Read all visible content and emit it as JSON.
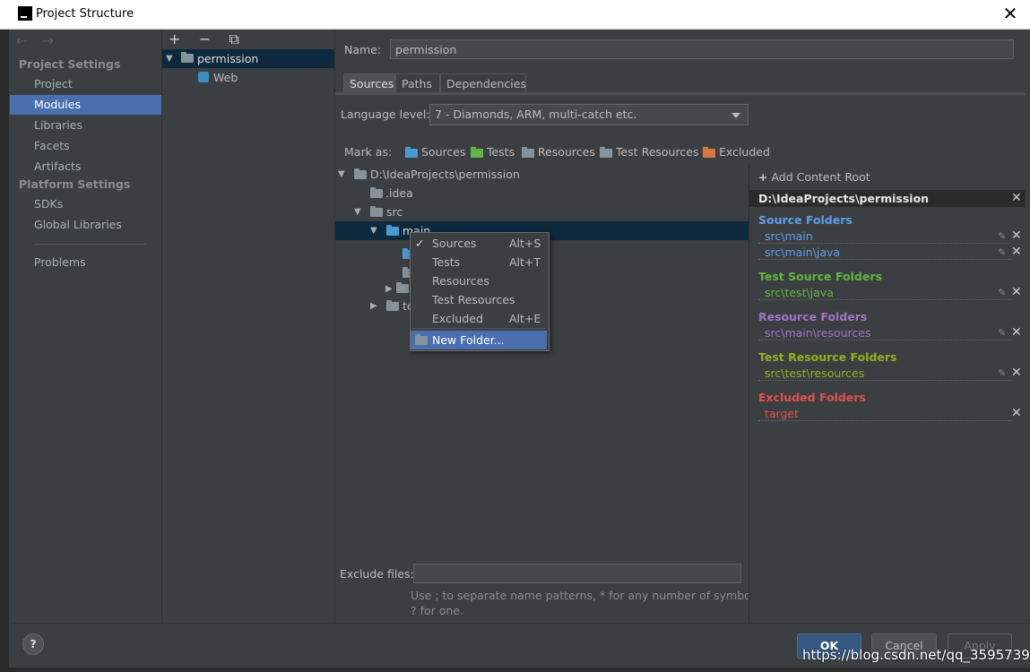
{
  "window": {
    "title": "Project Structure",
    "close": "✕"
  },
  "nav": {
    "back": "←",
    "forward": "→"
  },
  "sidebar": {
    "project_settings": "Project Settings",
    "items_project": [
      "Project",
      "Modules",
      "Libraries",
      "Facets",
      "Artifacts"
    ],
    "platform_settings": "Platform Settings",
    "items_platform": [
      "SDKs",
      "Global Libraries"
    ],
    "problems": "Problems",
    "selected": "Modules"
  },
  "modules": {
    "toolbar": {
      "add": "+",
      "remove": "−",
      "copy": "⧉"
    },
    "tree": [
      "permission",
      "Web"
    ]
  },
  "main": {
    "name_label": "Name:",
    "name_value": "permission",
    "tabs": [
      "Sources",
      "Paths",
      "Dependencies"
    ],
    "active_tab": "Sources",
    "language_level_label": "Language level:",
    "language_level_value": "7 - Diamonds, ARM, multi-catch etc.",
    "mark_as_label": "Mark as:",
    "mark_as": [
      "Sources",
      "Tests",
      "Resources",
      "Test Resources",
      "Excluded"
    ],
    "tree": [
      "D:\\IdeaProjects\\permission",
      ".idea",
      "src",
      "main",
      "te"
    ],
    "exclude_label": "Exclude files:",
    "exclude_value": "",
    "exclude_hint_1": "Use ; to separate name patterns, * for any number of symbols,",
    "exclude_hint_2": "? for one."
  },
  "context_menu": {
    "items": [
      {
        "label": "Sources",
        "shortcut": "Alt+S",
        "checked": "✓"
      },
      {
        "label": "Tests",
        "shortcut": "Alt+T"
      },
      {
        "label": "Resources",
        "shortcut": ""
      },
      {
        "label": "Test Resources",
        "shortcut": ""
      },
      {
        "label": "Excluded",
        "shortcut": "Alt+E"
      }
    ],
    "new_folder": "New Folder..."
  },
  "content_root": {
    "add_label": "Add Content Root",
    "add_plus": "+",
    "root_path": "D:\\IdeaProjects\\permission",
    "sections": [
      {
        "title": "Source Folders",
        "color": "#5c9ee8",
        "paths": [
          "src\\main",
          "src\\main\\java"
        ]
      },
      {
        "title": "Test Source Folders",
        "color": "#62b543",
        "paths": [
          "src\\test\\java"
        ]
      },
      {
        "title": "Resource Folders",
        "color": "#a173c9",
        "paths": [
          "src\\main\\resources"
        ]
      },
      {
        "title": "Test Resource Folders",
        "color": "#8fb11f",
        "paths": [
          "src\\test\\resources"
        ]
      },
      {
        "title": "Excluded Folders",
        "color": "#e0504f",
        "paths": [
          "target"
        ]
      }
    ]
  },
  "footer": {
    "help": "?",
    "ok": "OK",
    "cancel": "Cancel",
    "apply": "Apply"
  },
  "watermark": "https://blog.csdn.net/qq_35957398"
}
